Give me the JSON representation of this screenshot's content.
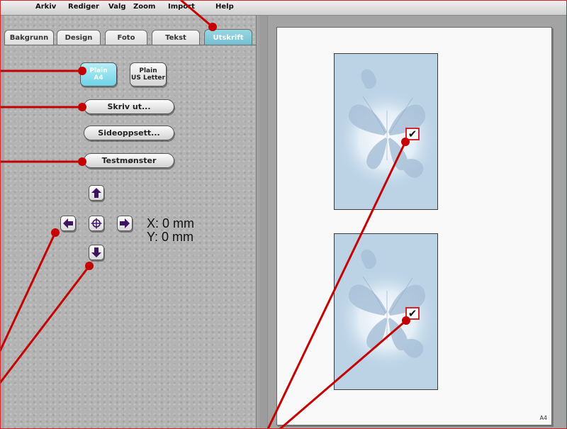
{
  "menubar": {
    "items": [
      "Arkiv",
      "Rediger",
      "Valg",
      "Zoom",
      "Import",
      "Help"
    ]
  },
  "tabs": [
    {
      "label": "Bakgrunn",
      "active": false
    },
    {
      "label": "Design",
      "active": false
    },
    {
      "label": "Foto",
      "active": false
    },
    {
      "label": "Tekst",
      "active": false
    },
    {
      "label": "Utskrift",
      "active": true
    }
  ],
  "paper": {
    "a4": {
      "line1": "Plain",
      "line2": "A4",
      "selected": true
    },
    "us_letter": {
      "line1": "Plain",
      "line2": "US Letter",
      "selected": false
    }
  },
  "buttons": {
    "print": "Skriv ut...",
    "page_setup": "Sideoppsett...",
    "test_pattern": "Testmønster"
  },
  "nudge": {
    "up_icon": "arrow-up-icon",
    "down_icon": "arrow-down-icon",
    "left_icon": "arrow-left-icon",
    "right_icon": "arrow-right-icon",
    "center_icon": "crosshair-icon"
  },
  "offset": {
    "x": "X: 0 mm",
    "y": "Y: 0 mm"
  },
  "preview": {
    "page_size_label": "A4",
    "tiles": [
      {
        "checked": true,
        "check_glyph": "✔"
      },
      {
        "checked": true,
        "check_glyph": "✔"
      }
    ]
  },
  "colors": {
    "active_tab": "#6fbfd2",
    "selected_paper": "#6fd3e6",
    "annotation": "#c40000",
    "arrow_fill": "#3d1460",
    "tile_bg": "#bcd3e6"
  }
}
